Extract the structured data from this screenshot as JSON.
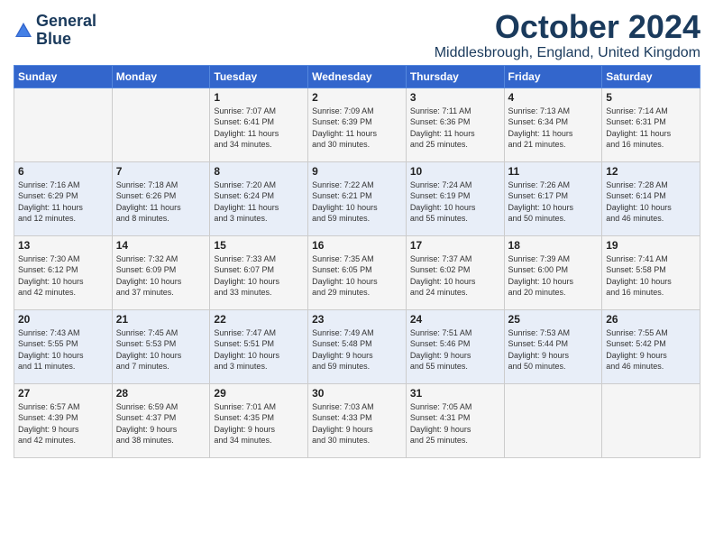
{
  "logo": {
    "line1": "General",
    "line2": "Blue"
  },
  "title": "October 2024",
  "location": "Middlesbrough, England, United Kingdom",
  "weekdays": [
    "Sunday",
    "Monday",
    "Tuesday",
    "Wednesday",
    "Thursday",
    "Friday",
    "Saturday"
  ],
  "weeks": [
    [
      {
        "day": "",
        "info": ""
      },
      {
        "day": "",
        "info": ""
      },
      {
        "day": "1",
        "info": "Sunrise: 7:07 AM\nSunset: 6:41 PM\nDaylight: 11 hours\nand 34 minutes."
      },
      {
        "day": "2",
        "info": "Sunrise: 7:09 AM\nSunset: 6:39 PM\nDaylight: 11 hours\nand 30 minutes."
      },
      {
        "day": "3",
        "info": "Sunrise: 7:11 AM\nSunset: 6:36 PM\nDaylight: 11 hours\nand 25 minutes."
      },
      {
        "day": "4",
        "info": "Sunrise: 7:13 AM\nSunset: 6:34 PM\nDaylight: 11 hours\nand 21 minutes."
      },
      {
        "day": "5",
        "info": "Sunrise: 7:14 AM\nSunset: 6:31 PM\nDaylight: 11 hours\nand 16 minutes."
      }
    ],
    [
      {
        "day": "6",
        "info": "Sunrise: 7:16 AM\nSunset: 6:29 PM\nDaylight: 11 hours\nand 12 minutes."
      },
      {
        "day": "7",
        "info": "Sunrise: 7:18 AM\nSunset: 6:26 PM\nDaylight: 11 hours\nand 8 minutes."
      },
      {
        "day": "8",
        "info": "Sunrise: 7:20 AM\nSunset: 6:24 PM\nDaylight: 11 hours\nand 3 minutes."
      },
      {
        "day": "9",
        "info": "Sunrise: 7:22 AM\nSunset: 6:21 PM\nDaylight: 10 hours\nand 59 minutes."
      },
      {
        "day": "10",
        "info": "Sunrise: 7:24 AM\nSunset: 6:19 PM\nDaylight: 10 hours\nand 55 minutes."
      },
      {
        "day": "11",
        "info": "Sunrise: 7:26 AM\nSunset: 6:17 PM\nDaylight: 10 hours\nand 50 minutes."
      },
      {
        "day": "12",
        "info": "Sunrise: 7:28 AM\nSunset: 6:14 PM\nDaylight: 10 hours\nand 46 minutes."
      }
    ],
    [
      {
        "day": "13",
        "info": "Sunrise: 7:30 AM\nSunset: 6:12 PM\nDaylight: 10 hours\nand 42 minutes."
      },
      {
        "day": "14",
        "info": "Sunrise: 7:32 AM\nSunset: 6:09 PM\nDaylight: 10 hours\nand 37 minutes."
      },
      {
        "day": "15",
        "info": "Sunrise: 7:33 AM\nSunset: 6:07 PM\nDaylight: 10 hours\nand 33 minutes."
      },
      {
        "day": "16",
        "info": "Sunrise: 7:35 AM\nSunset: 6:05 PM\nDaylight: 10 hours\nand 29 minutes."
      },
      {
        "day": "17",
        "info": "Sunrise: 7:37 AM\nSunset: 6:02 PM\nDaylight: 10 hours\nand 24 minutes."
      },
      {
        "day": "18",
        "info": "Sunrise: 7:39 AM\nSunset: 6:00 PM\nDaylight: 10 hours\nand 20 minutes."
      },
      {
        "day": "19",
        "info": "Sunrise: 7:41 AM\nSunset: 5:58 PM\nDaylight: 10 hours\nand 16 minutes."
      }
    ],
    [
      {
        "day": "20",
        "info": "Sunrise: 7:43 AM\nSunset: 5:55 PM\nDaylight: 10 hours\nand 11 minutes."
      },
      {
        "day": "21",
        "info": "Sunrise: 7:45 AM\nSunset: 5:53 PM\nDaylight: 10 hours\nand 7 minutes."
      },
      {
        "day": "22",
        "info": "Sunrise: 7:47 AM\nSunset: 5:51 PM\nDaylight: 10 hours\nand 3 minutes."
      },
      {
        "day": "23",
        "info": "Sunrise: 7:49 AM\nSunset: 5:48 PM\nDaylight: 9 hours\nand 59 minutes."
      },
      {
        "day": "24",
        "info": "Sunrise: 7:51 AM\nSunset: 5:46 PM\nDaylight: 9 hours\nand 55 minutes."
      },
      {
        "day": "25",
        "info": "Sunrise: 7:53 AM\nSunset: 5:44 PM\nDaylight: 9 hours\nand 50 minutes."
      },
      {
        "day": "26",
        "info": "Sunrise: 7:55 AM\nSunset: 5:42 PM\nDaylight: 9 hours\nand 46 minutes."
      }
    ],
    [
      {
        "day": "27",
        "info": "Sunrise: 6:57 AM\nSunset: 4:39 PM\nDaylight: 9 hours\nand 42 minutes."
      },
      {
        "day": "28",
        "info": "Sunrise: 6:59 AM\nSunset: 4:37 PM\nDaylight: 9 hours\nand 38 minutes."
      },
      {
        "day": "29",
        "info": "Sunrise: 7:01 AM\nSunset: 4:35 PM\nDaylight: 9 hours\nand 34 minutes."
      },
      {
        "day": "30",
        "info": "Sunrise: 7:03 AM\nSunset: 4:33 PM\nDaylight: 9 hours\nand 30 minutes."
      },
      {
        "day": "31",
        "info": "Sunrise: 7:05 AM\nSunset: 4:31 PM\nDaylight: 9 hours\nand 25 minutes."
      },
      {
        "day": "",
        "info": ""
      },
      {
        "day": "",
        "info": ""
      }
    ]
  ]
}
